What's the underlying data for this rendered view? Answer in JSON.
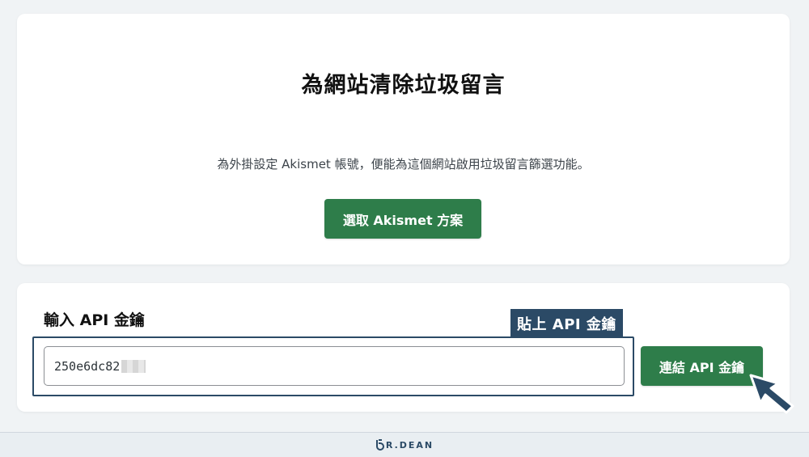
{
  "hero": {
    "title": "為網站清除垃圾留言",
    "description": "為外掛設定 Akismet 帳號，便能為這個網站啟用垃圾留言篩選功能。",
    "choose_button": "選取 Akismet 方案"
  },
  "api_section": {
    "heading": "輸入 API 金鑰",
    "input_value": "250e6dc82",
    "connect_button": "連結 API 金鑰"
  },
  "annotation": {
    "callout_label": "貼上 API 金鑰"
  },
  "footer": {
    "logo_text": "R.DEAN"
  },
  "colors": {
    "accent_green": "#2e7d4a",
    "annotation_navy": "#2b4a66",
    "page_background": "#f0f3f5"
  }
}
